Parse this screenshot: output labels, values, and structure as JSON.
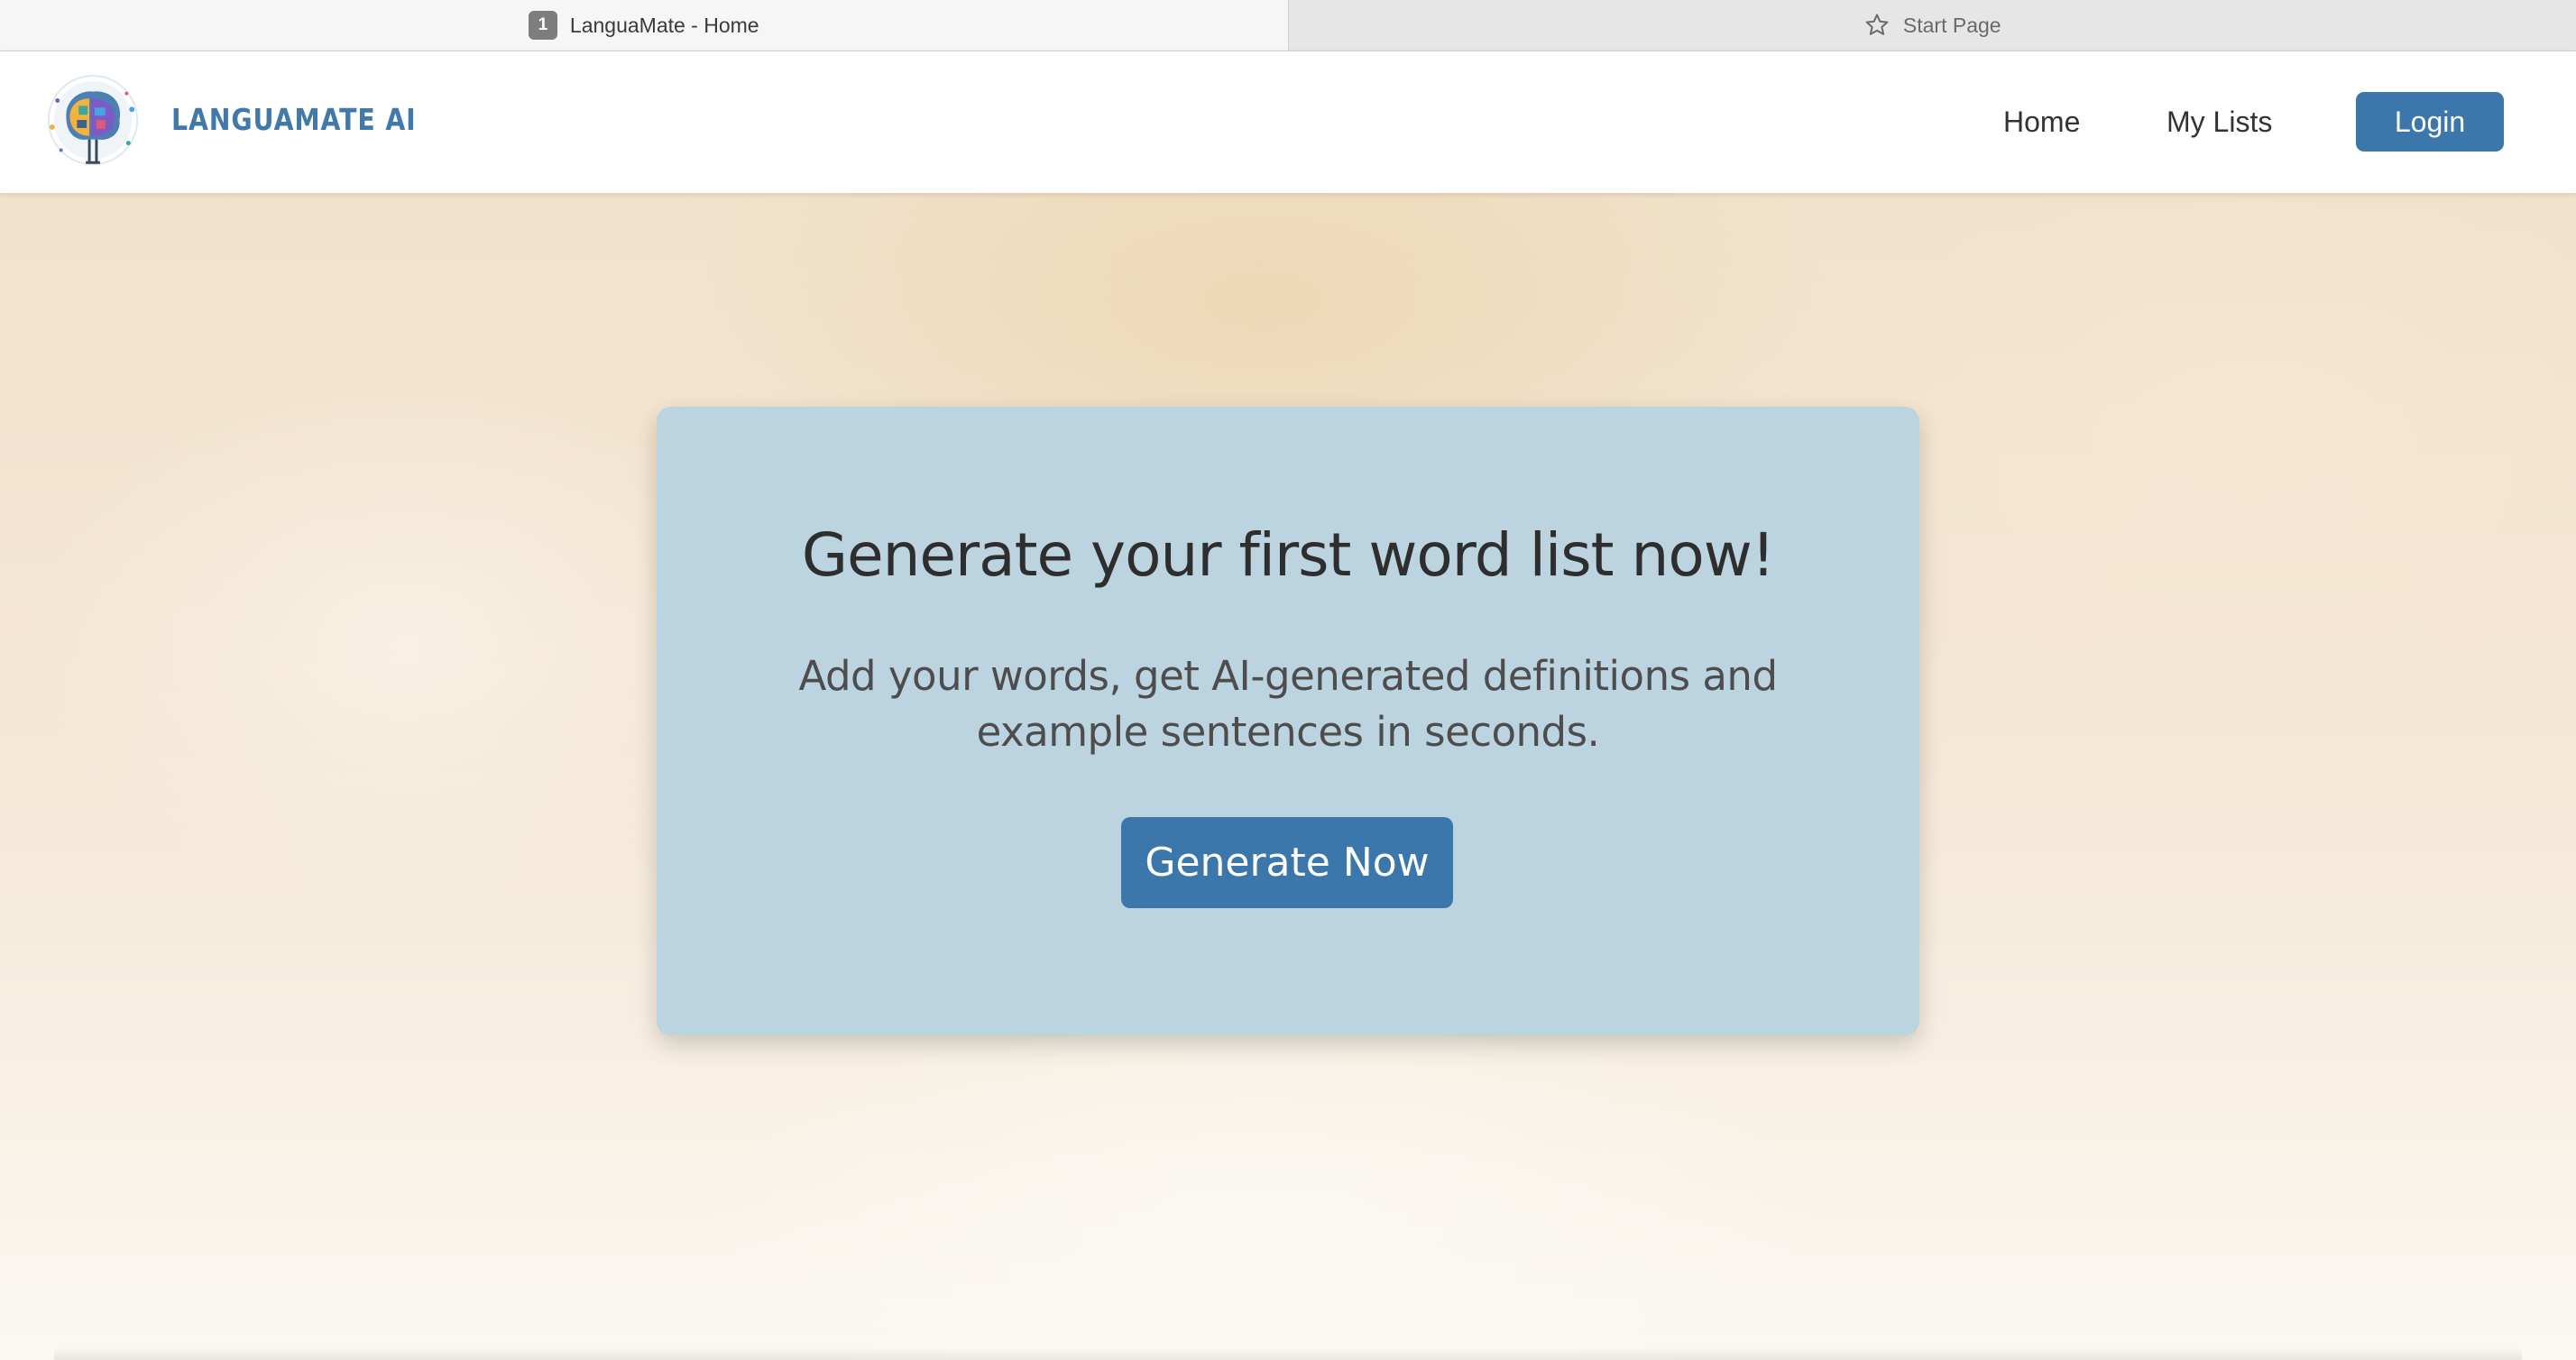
{
  "browser": {
    "tabs": [
      {
        "number": "1",
        "title": "LanguaMate - Home",
        "active": true
      },
      {
        "title": "Start Page",
        "icon": "star-icon",
        "active": false
      }
    ]
  },
  "header": {
    "brand": "LANGUAMATE AI",
    "logo_icon": "brain-logo-icon",
    "nav": {
      "home": "Home",
      "my_lists": "My Lists"
    },
    "login_label": "Login"
  },
  "hero": {
    "title": "Generate your first word list now!",
    "subtitle": "Add your words, get AI-generated definitions and example sentences in seconds.",
    "cta_label": "Generate Now"
  },
  "colors": {
    "accent": "#3c77ab",
    "brand_text": "#4179ab",
    "card_background": "#bcd4df"
  }
}
